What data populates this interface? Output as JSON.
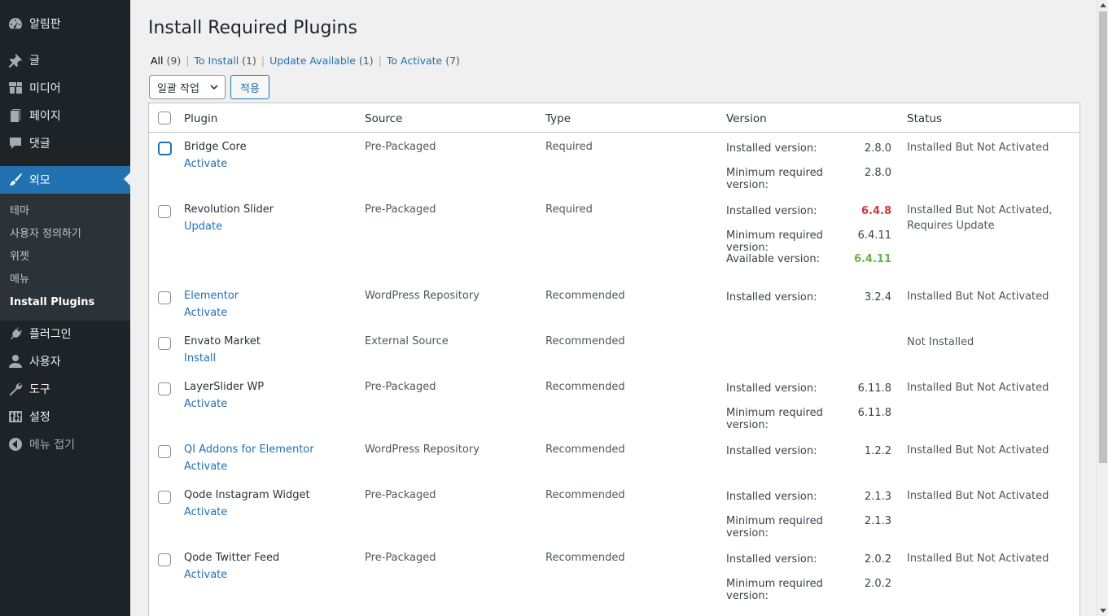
{
  "sidebar": {
    "items": [
      {
        "label": "알림판",
        "icon": "dashboard-icon"
      },
      {
        "label": "글",
        "icon": "pin-icon"
      },
      {
        "label": "미디어",
        "icon": "media-icon"
      },
      {
        "label": "페이지",
        "icon": "page-icon"
      },
      {
        "label": "댓글",
        "icon": "comment-icon"
      },
      {
        "label": "외모",
        "icon": "appearance-brush-icon"
      },
      {
        "label": "플러그인",
        "icon": "plugin-icon"
      },
      {
        "label": "사용자",
        "icon": "user-icon"
      },
      {
        "label": "도구",
        "icon": "wrench-icon"
      },
      {
        "label": "설정",
        "icon": "settings-icon"
      },
      {
        "label": "메뉴 접기",
        "icon": "collapse-icon"
      }
    ],
    "submenu": [
      "테마",
      "사용자 정의하기",
      "위젯",
      "메뉴",
      "Install Plugins"
    ]
  },
  "page": {
    "title": "Install Required Plugins",
    "filters": [
      {
        "label": "All",
        "count": "(9)"
      },
      {
        "label": "To Install",
        "count": "(1)"
      },
      {
        "label": "Update Available",
        "count": "(1)"
      },
      {
        "label": "To Activate",
        "count": "(7)"
      }
    ],
    "bulk_action": "일괄 작업",
    "apply": "적용"
  },
  "table": {
    "headers": {
      "plugin": "Plugin",
      "source": "Source",
      "type": "Type",
      "version": "Version",
      "status": "Status"
    },
    "rows": [
      {
        "name": "Bridge Core",
        "link": false,
        "action": "Activate",
        "source": "Pre-Packaged",
        "type": "Required",
        "versions": [
          {
            "label": "Installed version:",
            "value": "2.8.0"
          },
          {
            "label": "Minimum required version:",
            "value": "2.8.0"
          }
        ],
        "status": "Installed But Not Activated"
      },
      {
        "name": "Revolution Slider",
        "link": false,
        "action": "Update",
        "source": "Pre-Packaged",
        "type": "Required",
        "versions": [
          {
            "label": "Installed version:",
            "value": "6.4.8",
            "style": "red"
          },
          {
            "label": "Minimum required version:",
            "value": "6.4.11"
          },
          {
            "label": "Available version:",
            "value": "6.4.11",
            "style": "green"
          }
        ],
        "status": "Installed But Not Activated, Requires Update"
      },
      {
        "name": "Elementor",
        "link": true,
        "action": "Activate",
        "source": "WordPress Repository",
        "type": "Recommended",
        "versions": [
          {
            "label": "Installed version:",
            "value": "3.2.4"
          }
        ],
        "status": "Installed But Not Activated"
      },
      {
        "name": "Envato Market",
        "link": false,
        "action": "Install",
        "source": "External Source",
        "type": "Recommended",
        "versions": [],
        "status": "Not Installed"
      },
      {
        "name": "LayerSlider WP",
        "link": false,
        "action": "Activate",
        "source": "Pre-Packaged",
        "type": "Recommended",
        "versions": [
          {
            "label": "Installed version:",
            "value": "6.11.8"
          },
          {
            "label": "Minimum required version:",
            "value": "6.11.8"
          }
        ],
        "status": "Installed But Not Activated"
      },
      {
        "name": "QI Addons for Elementor",
        "link": true,
        "action": "Activate",
        "source": "WordPress Repository",
        "type": "Recommended",
        "versions": [
          {
            "label": "Installed version:",
            "value": "1.2.2"
          }
        ],
        "status": "Installed But Not Activated"
      },
      {
        "name": "Qode Instagram Widget",
        "link": false,
        "action": "Activate",
        "source": "Pre-Packaged",
        "type": "Recommended",
        "versions": [
          {
            "label": "Installed version:",
            "value": "2.1.3"
          },
          {
            "label": "Minimum required version:",
            "value": "2.1.3"
          }
        ],
        "status": "Installed But Not Activated"
      },
      {
        "name": "Qode Twitter Feed",
        "link": false,
        "action": "Activate",
        "source": "Pre-Packaged",
        "type": "Recommended",
        "versions": [
          {
            "label": "Installed version:",
            "value": "2.0.2"
          },
          {
            "label": "Minimum required version:",
            "value": "2.0.2"
          }
        ],
        "status": "Installed But Not Activated"
      }
    ]
  }
}
